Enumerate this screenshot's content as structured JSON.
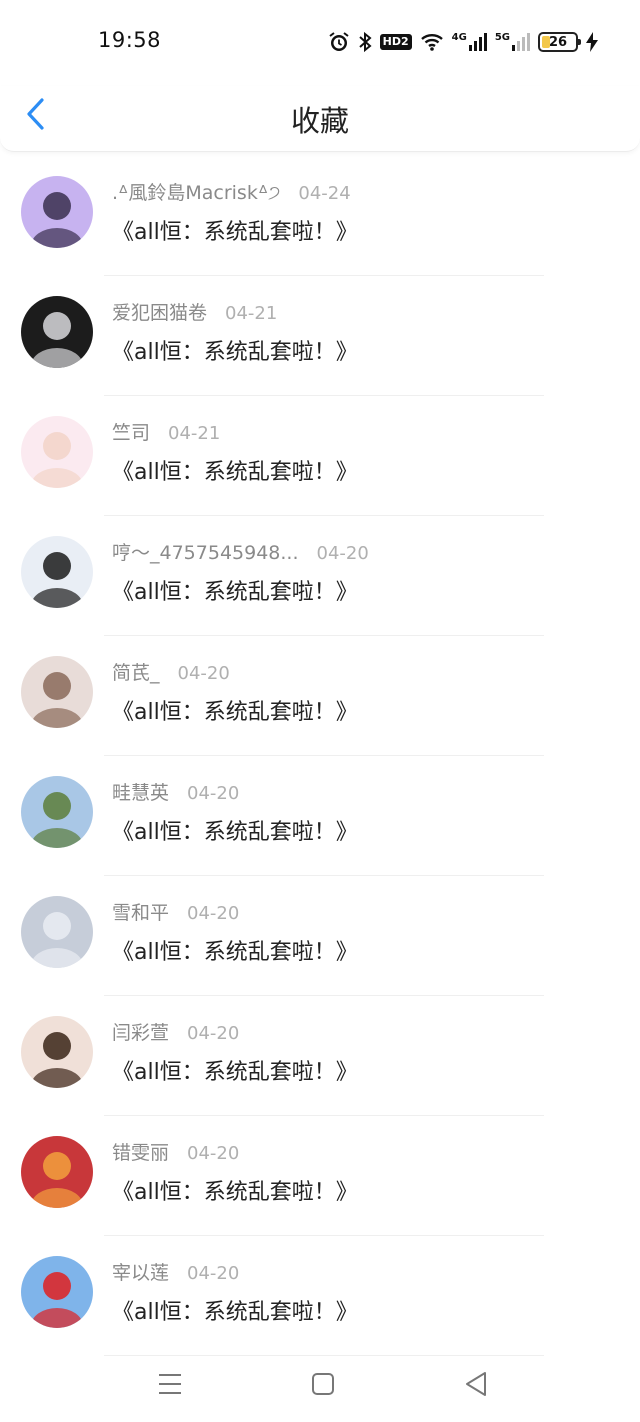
{
  "status_bar": {
    "time": "19:58",
    "icons": [
      "alarm-icon",
      "bluetooth-icon",
      "hd-icon",
      "wifi-icon",
      "signal-4g-icon",
      "signal-5g-icon",
      "battery-icon",
      "charging-icon"
    ],
    "hd_label": "HD2",
    "net1_label": "4G",
    "net2_label": "5G",
    "battery_level": "26",
    "battery_fraction": 0.26
  },
  "header": {
    "back_icon": "chevron-left-icon",
    "title": "收藏",
    "accent_color": "#2c8df4"
  },
  "favorites": [
    {
      "username": ".ᐞ風鈴島Macriskᐞ੭",
      "date": "04-24",
      "title": "《all恒：系统乱套啦！》",
      "avatar_color": "#c7b3f0",
      "avatar_accent": "#3a2f4f"
    },
    {
      "username": "爱犯困猫卷",
      "date": "04-21",
      "title": "《all恒：系统乱套啦！》",
      "avatar_color": "#1c1c1c",
      "avatar_accent": "#d8d8dc"
    },
    {
      "username": "竺司",
      "date": "04-21",
      "title": "《all恒：系统乱套啦！》",
      "avatar_color": "#fbeaf0",
      "avatar_accent": "#f2d4c8"
    },
    {
      "username": "哼～_4757545948...",
      "date": "04-20",
      "title": "《all恒：系统乱套啦！》",
      "avatar_color": "#e9eef5",
      "avatar_accent": "#1b1b1b"
    },
    {
      "username": "简芪_",
      "date": "04-20",
      "title": "《all恒：系统乱套啦！》",
      "avatar_color": "#e8dcd8",
      "avatar_accent": "#8a6a5a"
    },
    {
      "username": "畦慧英",
      "date": "04-20",
      "title": "《all恒：系统乱套啦！》",
      "avatar_color": "#a9c7e6",
      "avatar_accent": "#5d7e3a"
    },
    {
      "username": "雪和平",
      "date": "04-20",
      "title": "《all恒：系统乱套啦！》",
      "avatar_color": "#c6cdd9",
      "avatar_accent": "#e9ecf2"
    },
    {
      "username": "闫彩萱",
      "date": "04-20",
      "title": "《all恒：系统乱套啦！》",
      "avatar_color": "#f0e0d8",
      "avatar_accent": "#3a2418"
    },
    {
      "username": "错雯丽",
      "date": "04-20",
      "title": "《all恒：系统乱套啦！》",
      "avatar_color": "#c8373a",
      "avatar_accent": "#f2a03d"
    },
    {
      "username": "宰以莲",
      "date": "04-20",
      "title": "《all恒：系统乱套啦！》",
      "avatar_color": "#7fb4ea",
      "avatar_accent": "#e02020"
    }
  ],
  "nav_bar": {
    "icons": [
      "menu-icon",
      "home-icon",
      "back-icon"
    ]
  }
}
